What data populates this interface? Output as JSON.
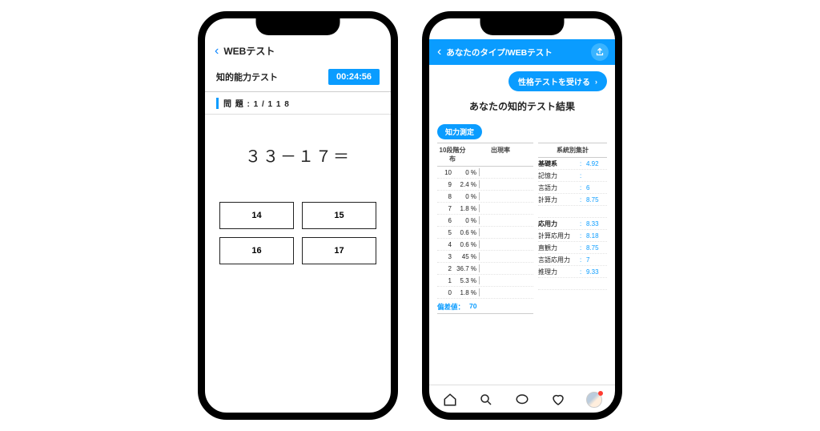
{
  "left": {
    "header_title": "WEBテスト",
    "subtitle": "知的能力テスト",
    "timer": "00:24:56",
    "progress_label": "問 題 : 1  /  1 1 8",
    "question": "３３－１７＝",
    "answers": [
      "14",
      "15",
      "16",
      "17"
    ]
  },
  "right": {
    "header_title": "あなたのタイプ/WEBテスト",
    "personality_btn": "性格テストを受ける",
    "result_title": "あなたの知的テスト結果",
    "section_badge": "知力測定",
    "col_dist": "10段階分布",
    "col_rate": "出現率",
    "col_stat": "系統別集計",
    "distribution": [
      {
        "n": "10",
        "pct": "0 %",
        "bar": 0
      },
      {
        "n": "9",
        "pct": "2.4 %",
        "bar": 2.4
      },
      {
        "n": "8",
        "pct": "0 %",
        "bar": 0
      },
      {
        "n": "7",
        "pct": "1.8 %",
        "bar": 1.8
      },
      {
        "n": "6",
        "pct": "0 %",
        "bar": 0
      },
      {
        "n": "5",
        "pct": "0.6 %",
        "bar": 0.6
      },
      {
        "n": "4",
        "pct": "0.6 %",
        "bar": 0.6
      },
      {
        "n": "3",
        "pct": "45 %",
        "bar": 45
      },
      {
        "n": "2",
        "pct": "36.7 %",
        "bar": 36.7
      },
      {
        "n": "1",
        "pct": "5.3 %",
        "bar": 5.3
      },
      {
        "n": "0",
        "pct": "1.8 %",
        "bar": 1.8
      }
    ],
    "stats": [
      {
        "k": "基礎系",
        "v": "4.92",
        "bold": true
      },
      {
        "k": "記憶力",
        "v": ""
      },
      {
        "k": "言語力",
        "v": "6"
      },
      {
        "k": "計算力",
        "v": "8.75"
      },
      {
        "k": "",
        "v": ""
      },
      {
        "k": "応用力",
        "v": "8.33",
        "bold": true
      },
      {
        "k": "計算応用力",
        "v": "8.18"
      },
      {
        "k": "直観力",
        "v": "8.75"
      },
      {
        "k": "言語応用力",
        "v": "7"
      },
      {
        "k": "推理力",
        "v": "9.33"
      },
      {
        "k": "",
        "v": ""
      }
    ],
    "deviation_label": "偏差値：",
    "deviation_value": "70"
  }
}
